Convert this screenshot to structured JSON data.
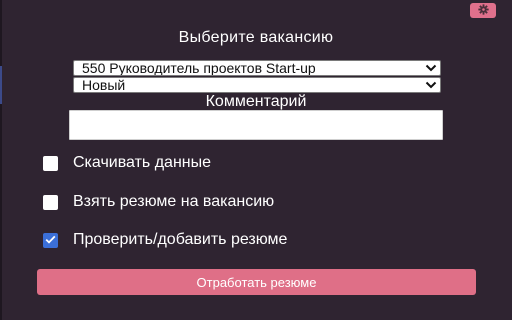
{
  "header": {
    "settings_icon": "gear-icon",
    "title": "Выберите вакансию"
  },
  "vacancy_select": {
    "selected": "550 Руководитель проектов Start-up",
    "icon": "chevron-down-icon"
  },
  "status_select": {
    "selected": "Новый",
    "icon": "chevron-down-icon"
  },
  "comment": {
    "label": "Комментарий",
    "value": "",
    "placeholder": ""
  },
  "options": [
    {
      "label": "Скачивать данные",
      "checked": false
    },
    {
      "label": "Взять резюме на вакансию",
      "checked": false
    },
    {
      "label": "Проверить/добавить резюме",
      "checked": true
    }
  ],
  "actions": {
    "submit_label": "Отработать резюме"
  },
  "colors": {
    "background": "#2f2431",
    "accent": "#df6f87",
    "checkbox_checked": "#3b6fd8"
  }
}
